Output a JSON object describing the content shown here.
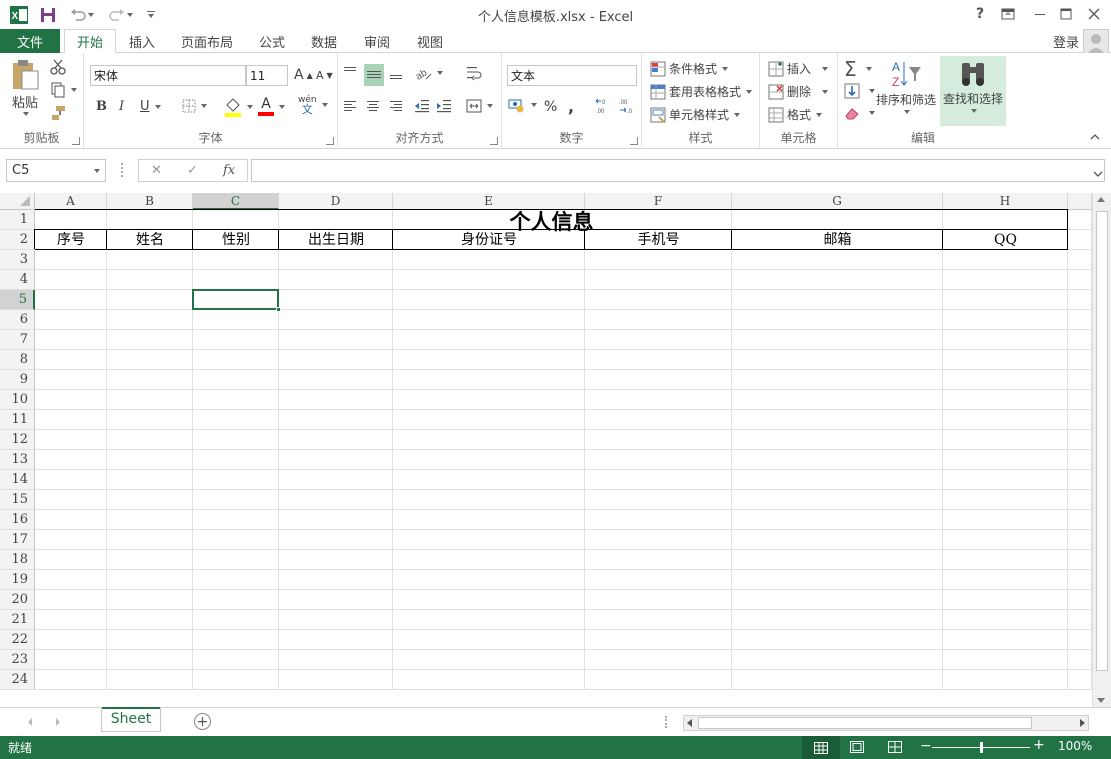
{
  "window": {
    "title": "个人信息模板.xlsx - Excel",
    "help": "?",
    "login": "登录"
  },
  "ribbon_tabs": {
    "file": "文件",
    "items": [
      "开始",
      "插入",
      "页面布局",
      "公式",
      "数据",
      "审阅",
      "视图"
    ],
    "active_index": 0
  },
  "clipboard": {
    "paste": "粘贴",
    "label": "剪贴板"
  },
  "font": {
    "family": "宋体",
    "size": "11",
    "bold": "B",
    "italic": "I",
    "underline": "U",
    "phonetic_top": "wén",
    "phonetic_bottom": "文",
    "grow": "A",
    "shrink": "A",
    "color_letter": "A",
    "label": "字体"
  },
  "alignment": {
    "label": "对齐方式"
  },
  "number": {
    "format": "文本",
    "percent": "%",
    "comma": ",",
    "label": "数字"
  },
  "styles": {
    "conditional": "条件格式",
    "table": "套用表格格式",
    "cell": "单元格样式",
    "label": "样式"
  },
  "cells": {
    "insert": "插入",
    "delete": "删除",
    "format": "格式",
    "label": "单元格"
  },
  "editing": {
    "sort": "排序和筛选",
    "find": "查找和选择",
    "sigma": "Σ",
    "label": "编辑"
  },
  "formula_bar": {
    "name_box": "C5",
    "fx": "fx",
    "cancel": "✕",
    "enter": "✓",
    "formula": ""
  },
  "sheet": {
    "columns": [
      "A",
      "B",
      "C",
      "D",
      "E",
      "F",
      "G",
      "H"
    ],
    "rows": [
      "1",
      "2",
      "3",
      "4",
      "5",
      "6",
      "7",
      "8",
      "9",
      "10",
      "11",
      "12",
      "13",
      "14",
      "15",
      "16",
      "17",
      "18",
      "19",
      "20",
      "21",
      "22",
      "23",
      "24"
    ],
    "selected_column": "C",
    "selected_row": "5",
    "title": "个人信息",
    "headers": [
      "序号",
      "姓名",
      "性别",
      "出生日期",
      "身份证号",
      "手机号",
      "邮箱",
      "QQ"
    ]
  },
  "sheet_tabs": {
    "active": "Sheet",
    "add": "+"
  },
  "status": {
    "ready": "就绪",
    "zoom": "100%",
    "zoom_fraction": 0.5
  },
  "colors": {
    "accent": "#217346",
    "selection_fill": "#d2d2d2"
  }
}
